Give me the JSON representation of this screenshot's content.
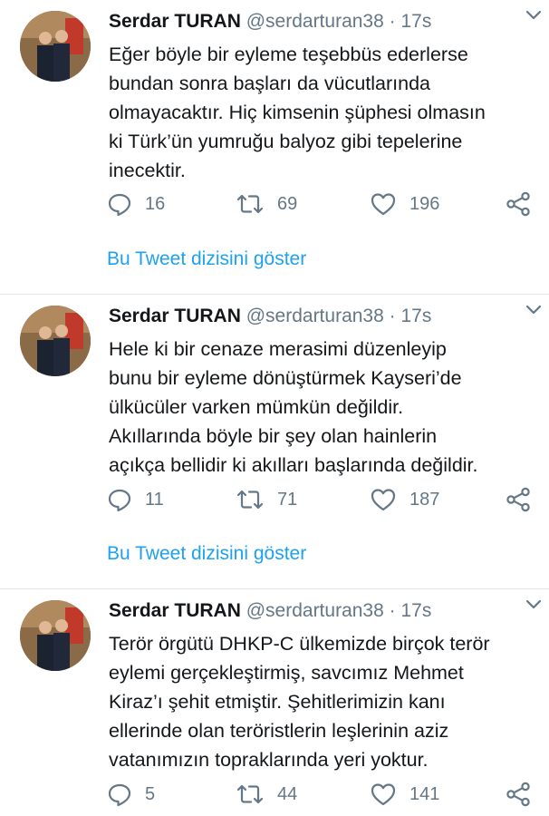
{
  "tweets": [
    {
      "name": "Serdar TURAN",
      "handle": "@serdarturan38",
      "dot": "·",
      "time": "17s",
      "text": "Eğer böyle bir eyleme teşebbüs ederlerse\nbundan sonra başları da vücutlarında\nolmayacaktır. Hiç kimsenin şüphesi olmasın\nki Türk’ün yumruğu balyoz gibi tepelerine\ninecektir.",
      "replies": "16",
      "retweets": "69",
      "likes": "196",
      "thread_link": "Bu Tweet dizisini göster"
    },
    {
      "name": "Serdar TURAN",
      "handle": "@serdarturan38",
      "dot": "·",
      "time": "17s",
      "text": "Hele ki bir cenaze merasimi düzenleyip\nbunu bir eyleme dönüştürmek Kayseri’de\nülkücüler varken mümkün değildir.\nAkıllarında böyle bir şey olan hainlerin\naçıkça bellidir ki akılları başlarında değildir.",
      "replies": "11",
      "retweets": "71",
      "likes": "187",
      "thread_link": "Bu Tweet dizisini göster"
    },
    {
      "name": "Serdar TURAN",
      "handle": "@serdarturan38",
      "dot": "·",
      "time": "17s",
      "text": "Terör örgütü DHKP-C ülkemizde birçok terör\neylemi gerçekleştirmiş, savcımız Mehmet\nKiraz’ı şehit etmiştir. Şehitlerimizin kanı\nellerinde olan teröristlerin leşlerinin aziz\nvatanımızın topraklarında yeri yoktur.",
      "replies": "5",
      "retweets": "44",
      "likes": "141"
    }
  ],
  "colors": {
    "text": "#14171a",
    "muted": "#657786",
    "link": "#1da1f2",
    "divider": "#e1e8ed"
  },
  "icons": [
    "reply-icon",
    "retweet-icon",
    "like-icon",
    "share-icon",
    "chevron-down-icon"
  ]
}
